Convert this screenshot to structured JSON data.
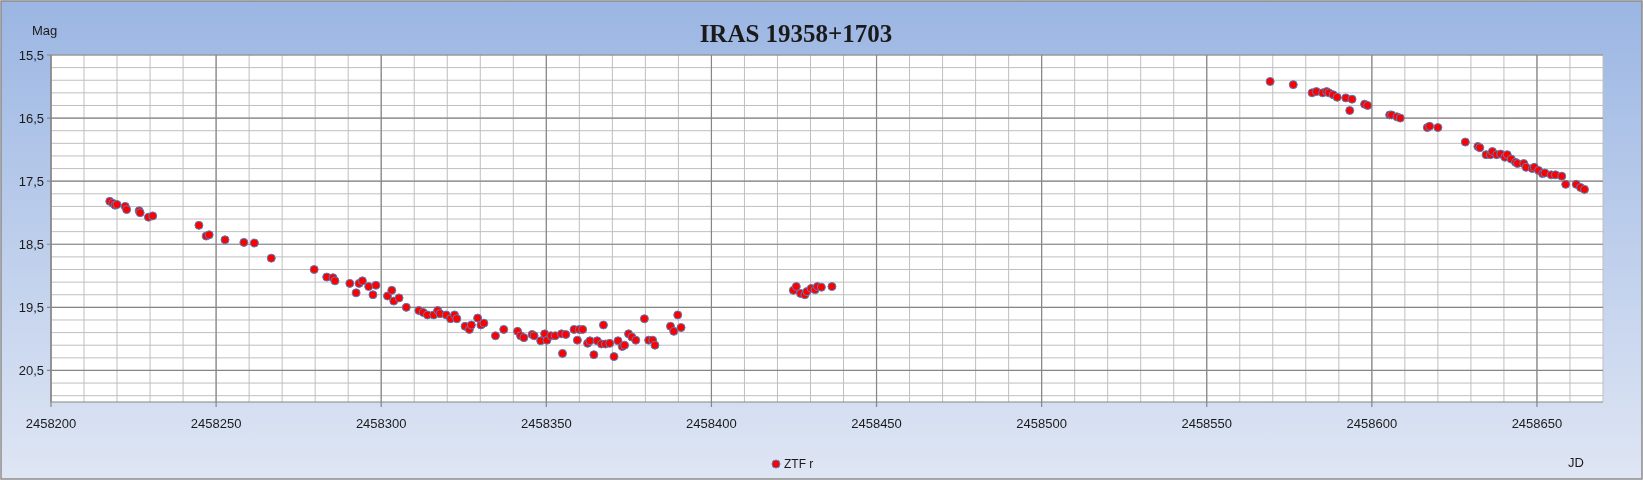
{
  "chart_data": {
    "type": "scatter",
    "title": "IRAS 19358+1703",
    "xlabel": "JD",
    "ylabel": "Mag",
    "grid": true,
    "xlim": [
      2458200,
      2458670
    ],
    "ylim": [
      21,
      15.5
    ],
    "xticks": [
      2458200,
      2458250,
      2458300,
      2458350,
      2458400,
      2458450,
      2458500,
      2458550,
      2458600,
      2458650
    ],
    "yticks": [
      {
        "value": 15.5,
        "label": "15,5"
      },
      {
        "value": 16.5,
        "label": "16,5"
      },
      {
        "value": 17.5,
        "label": "17,5"
      },
      {
        "value": 18.5,
        "label": "18,5"
      },
      {
        "value": 19.5,
        "label": "19,5"
      },
      {
        "value": 20.5,
        "label": "20,5"
      }
    ],
    "x": [
      2458217.8,
      2458218.7,
      2458219.4,
      2458220.0,
      2458222.5,
      2458222.9,
      2458226.7,
      2458227.0,
      2458229.5,
      2458230.8,
      2458244.8,
      2458247.0,
      2458247.9,
      2458252.7,
      2458258.4,
      2458261.6,
      2458266.7,
      2458279.7,
      2458283.5,
      2458285.4,
      2458286.0,
      2458290.5,
      2458292.4,
      2458293.3,
      2458294.3,
      2458296.2,
      2458297.5,
      2458298.4,
      2458301.9,
      2458303.2,
      2458303.8,
      2458305.4,
      2458307.6,
      2458311.4,
      2458312.7,
      2458314.0,
      2458315.9,
      2458317.1,
      2458317.8,
      2458319.7,
      2458321.0,
      2458322.2,
      2458322.9,
      2458325.4,
      2458326.7,
      2458327.3,
      2458329.2,
      2458330.2,
      2458331.1,
      2458334.6,
      2458337.1,
      2458341.3,
      2458342.2,
      2458343.2,
      2458345.7,
      2458346.3,
      2458348.3,
      2458349.5,
      2458350.2,
      2458351.4,
      2458352.7,
      2458354.6,
      2458354.9,
      2458355.9,
      2458358.4,
      2458359.4,
      2458360.0,
      2458361.0,
      2458362.5,
      2458363.2,
      2458364.4,
      2458365.4,
      2458366.7,
      2458367.3,
      2458367.9,
      2458369.2,
      2458370.5,
      2458371.7,
      2458373.0,
      2458373.7,
      2458374.9,
      2458375.9,
      2458377.1,
      2458379.7,
      2458381.0,
      2458382.2,
      2458382.9,
      2458387.6,
      2458388.6,
      2458389.8,
      2458390.8,
      2458424.8,
      2458425.7,
      2458427.0,
      2458428.3,
      2458428.9,
      2458430.2,
      2458431.4,
      2458432.1,
      2458433.3,
      2458436.5,
      2458569.2,
      2458576.2,
      2458581.9,
      2458583.2,
      2458585.1,
      2458586.3,
      2458587.0,
      2458588.3,
      2458589.5,
      2458592.1,
      2458593.3,
      2458594.0,
      2458597.8,
      2458598.7,
      2458605.4,
      2458606.0,
      2458607.6,
      2458608.6,
      2458616.8,
      2458617.5,
      2458620.0,
      2458628.3,
      2458632.1,
      2458632.7,
      2458634.6,
      2458635.9,
      2458636.5,
      2458637.8,
      2458639.0,
      2458640.3,
      2458641.0,
      2458642.2,
      2458643.5,
      2458644.1,
      2458646.0,
      2458646.7,
      2458648.6,
      2458649.2,
      2458650.5,
      2458651.7,
      2458652.4,
      2458654.3,
      2458655.6,
      2458657.5,
      2458658.7,
      2458661.9,
      2458663.2,
      2458664.4
    ],
    "series": [
      {
        "name": "ZTF r",
        "color": "#ff0000",
        "values": [
          17.82,
          17.85,
          17.88,
          17.87,
          17.9,
          17.95,
          17.97,
          18.0,
          18.07,
          18.05,
          18.2,
          18.37,
          18.35,
          18.43,
          18.47,
          18.48,
          18.72,
          18.9,
          19.02,
          19.03,
          19.08,
          19.12,
          19.27,
          19.12,
          19.08,
          19.17,
          19.3,
          19.15,
          19.32,
          19.23,
          19.4,
          19.35,
          19.5,
          19.55,
          19.58,
          19.62,
          19.62,
          19.55,
          19.6,
          19.62,
          19.68,
          19.62,
          19.68,
          19.8,
          19.85,
          19.78,
          19.67,
          19.78,
          19.75,
          19.95,
          19.85,
          19.88,
          19.95,
          19.98,
          19.93,
          19.95,
          20.03,
          19.92,
          20.02,
          19.95,
          19.95,
          19.92,
          20.23,
          19.93,
          19.85,
          20.02,
          19.85,
          19.85,
          20.07,
          20.03,
          20.25,
          20.03,
          20.08,
          19.78,
          20.08,
          20.07,
          20.28,
          20.03,
          20.12,
          20.1,
          19.92,
          19.97,
          20.02,
          19.68,
          20.02,
          20.02,
          20.1,
          19.8,
          19.88,
          19.62,
          19.82,
          19.23,
          19.17,
          19.28,
          19.3,
          19.25,
          19.2,
          19.22,
          19.17,
          19.18,
          19.17,
          15.92,
          15.97,
          16.1,
          16.08,
          16.1,
          16.08,
          16.1,
          16.13,
          16.17,
          16.18,
          16.38,
          16.2,
          16.28,
          16.3,
          16.45,
          16.45,
          16.48,
          16.5,
          16.65,
          16.63,
          16.65,
          16.88,
          16.95,
          16.97,
          17.08,
          17.08,
          17.03,
          17.08,
          17.07,
          17.12,
          17.08,
          17.15,
          17.2,
          17.22,
          17.22,
          17.28,
          17.3,
          17.28,
          17.33,
          17.38,
          17.37,
          17.4,
          17.4,
          17.42,
          17.55,
          17.55,
          17.6,
          17.63
        ]
      }
    ]
  }
}
